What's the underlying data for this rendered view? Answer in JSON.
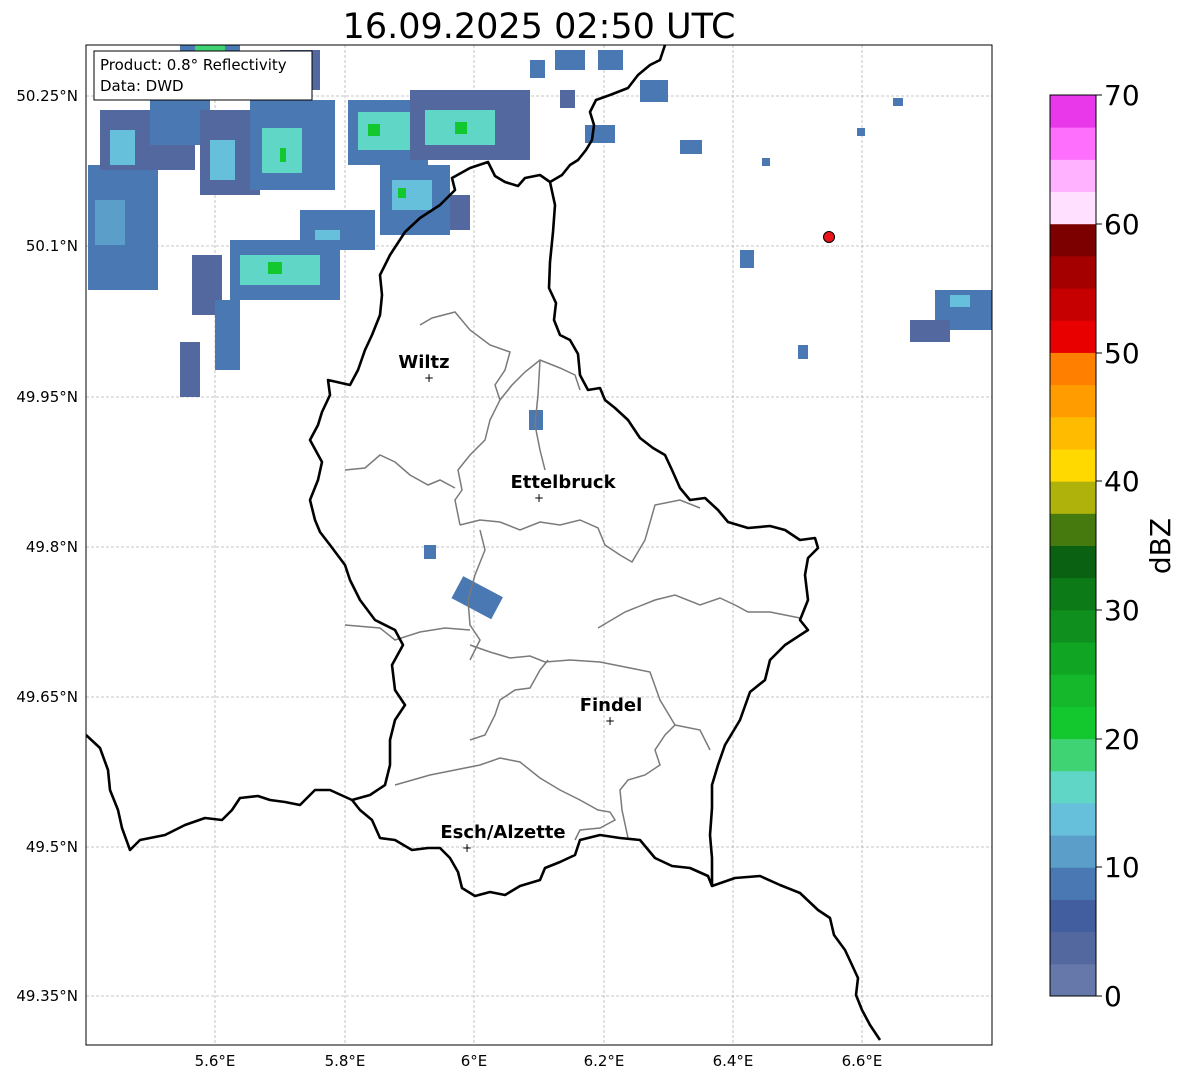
{
  "title": "16.09.2025 02:50 UTC",
  "info_box": {
    "product": "Product: 0.8° Reflectivity",
    "source": "Data: DWD"
  },
  "map": {
    "lon_ticks": [
      "5.6°E",
      "5.8°E",
      "6°E",
      "6.2°E",
      "6.4°E",
      "6.6°E"
    ],
    "lat_ticks": [
      "50.25°N",
      "50.1°N",
      "49.95°N",
      "49.8°N",
      "49.65°N",
      "49.5°N",
      "49.35°N"
    ],
    "cities": [
      {
        "name": "Wiltz",
        "lon": 5.93,
        "lat": 49.97
      },
      {
        "name": "Ettelbruck",
        "lon": 6.1,
        "lat": 49.85
      },
      {
        "name": "Findel",
        "lon": 6.21,
        "lat": 49.63
      },
      {
        "name": "Esch/Alzette",
        "lon": 5.99,
        "lat": 49.5
      }
    ],
    "radar_site_marker_color": "#e8161b"
  },
  "colorbar": {
    "label": "dBZ",
    "ticks": [
      "0",
      "10",
      "20",
      "30",
      "40",
      "50",
      "60",
      "70"
    ],
    "colors": [
      "#6677aa",
      "#52689f",
      "#435e9e",
      "#4a78b2",
      "#5a9ec9",
      "#66bfdb",
      "#5fd6c6",
      "#3fd374",
      "#13c72f",
      "#14b82a",
      "#11a524",
      "#0f8f1d",
      "#0d7a18",
      "#0b6112",
      "#467a0f",
      "#afb20a",
      "#ffd900",
      "#ffbb00",
      "#ff9d00",
      "#ff7f00",
      "#e80000",
      "#c60000",
      "#a40000",
      "#7c0000",
      "#ffe1ff",
      "#ffb2ff",
      "#ff6ffd",
      "#e838ea"
    ]
  }
}
